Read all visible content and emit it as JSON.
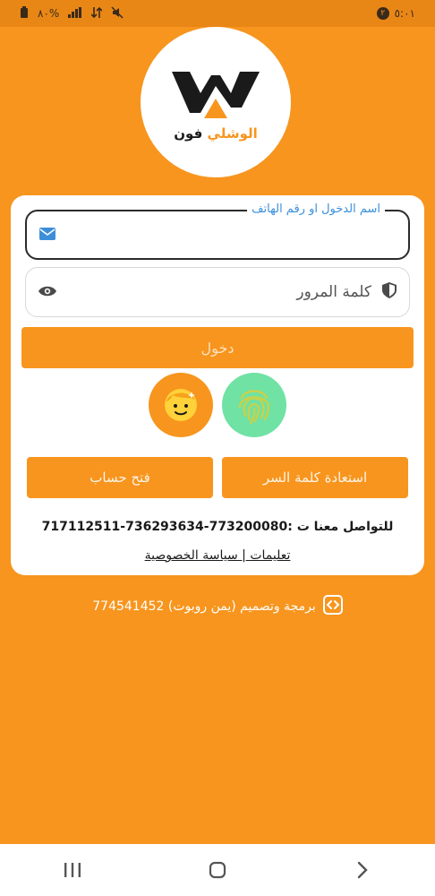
{
  "status_bar": {
    "time": "٥:٠١",
    "notification_badge": "٢",
    "battery": "٨٠%"
  },
  "logo": {
    "brand_word_1": "الوشلي",
    "brand_word_2": "فون"
  },
  "login": {
    "username_label": "اسم الدخول او رقم الهاتف",
    "username_value": "",
    "password_placeholder": "كلمة المرور",
    "login_button": "دخول"
  },
  "actions": {
    "reset_password": "استعادة كلمة السر",
    "open_account": "فتح حساب"
  },
  "contact": {
    "text": "للتواصل معنا ت :773200080-736293634-717112511"
  },
  "links": {
    "text": "تعليمات | سياسة الخصوصية"
  },
  "footer": {
    "credit": "برمجة وتصميم (يمن روبوت) 774541452"
  },
  "colors": {
    "primary": "#f7951e",
    "fingerprint_bg": "#6fe2a4",
    "label_blue": "#3b8fd9"
  }
}
